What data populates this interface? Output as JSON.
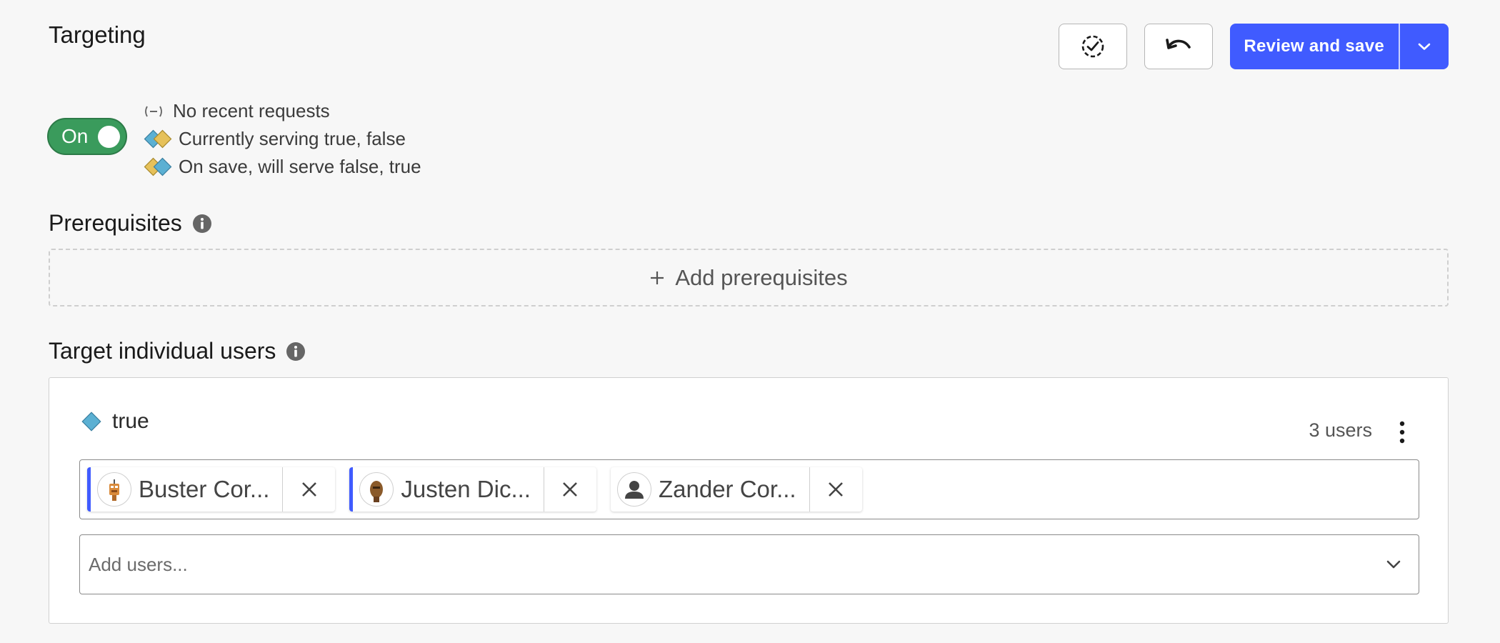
{
  "header": {
    "title": "Targeting",
    "save_label": "Review and save"
  },
  "toggle": {
    "label": "On",
    "state": true
  },
  "status": {
    "no_requests": "No recent requests",
    "currently_serving": "Currently serving true, false",
    "on_save": "On save, will serve false, true"
  },
  "prerequisites": {
    "heading": "Prerequisites",
    "add_label": "Add prerequisites"
  },
  "target_users": {
    "heading": "Target individual users",
    "variation": "true",
    "count_label": "3 users",
    "users": [
      {
        "name": "Buster Cor..."
      },
      {
        "name": "Justen Dic..."
      },
      {
        "name": "Zander Cor..."
      }
    ],
    "add_placeholder": "Add users..."
  },
  "colors": {
    "primary": "#405bff",
    "toggle_on": "#3a9b5c",
    "variation_true": "#5bb0d3",
    "variation_false": "#e6c15a"
  }
}
